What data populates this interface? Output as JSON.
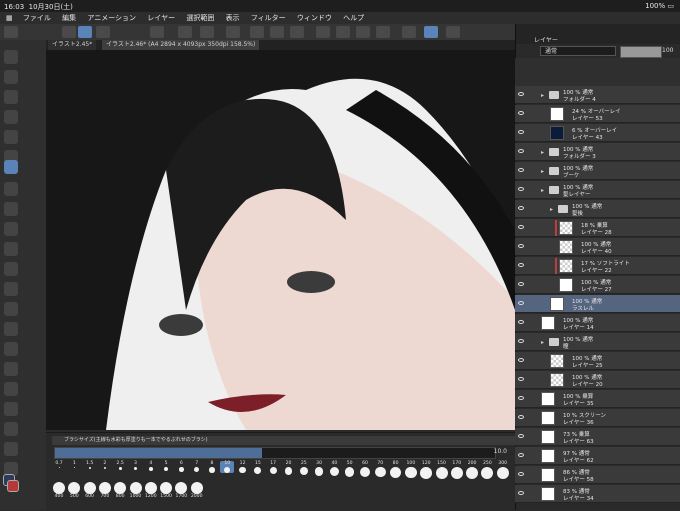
{
  "status": {
    "time": "16:03",
    "date": "10月30日(土)",
    "battery": "100%"
  },
  "menu": [
    "ファイル",
    "編集",
    "アニメーション",
    "レイヤー",
    "選択範囲",
    "表示",
    "フィルター",
    "ウィンドウ",
    "ヘルプ"
  ],
  "canvas_tabs": [
    {
      "label": "イラスト2.45*"
    },
    {
      "label": "イラスト2.46* (A4 2894 x 4093px 350dpi 158.5%)"
    }
  ],
  "brush_panel": {
    "title": "ブラシサイズ(主線も水彩も厚塗りも一本でやるぶれせのブラシ)",
    "current_value": "10.0",
    "selected_size": "10",
    "fill_fraction": 0.47,
    "sizes_row1": [
      "0.7",
      "1",
      "1.5",
      "2",
      "2.5",
      "3",
      "4",
      "5",
      "6",
      "7",
      "8",
      "10",
      "12",
      "15",
      "17",
      "20",
      "25",
      "30",
      "40",
      "50",
      "60",
      "70",
      "80",
      "100",
      "120",
      "150",
      "170",
      "200",
      "250",
      "300"
    ],
    "sizes_row2": [
      "400",
      "500",
      "600",
      "700",
      "800",
      "1000",
      "1200",
      "1500",
      "1700",
      "2000"
    ]
  },
  "layer_panel": {
    "tab_label": "レイヤー",
    "blend_mode": "通常",
    "opacity": "100",
    "layers": [
      {
        "line1": "100 % 通常",
        "line2": "フォルダー 4",
        "kind": "folder",
        "indent": 0
      },
      {
        "line1": "24 % オーバーレイ",
        "line2": "レイヤー 53",
        "kind": "layer",
        "thumb": "white",
        "indent": 1
      },
      {
        "line1": "6 % オーバーレイ",
        "line2": "レイヤー 43",
        "kind": "layer",
        "thumb": "dark",
        "indent": 1
      },
      {
        "line1": "100 % 通常",
        "line2": "フォルダー 3",
        "kind": "folder",
        "indent": 0
      },
      {
        "line1": "100 % 通常",
        "line2": "ブーケ",
        "kind": "folder",
        "indent": 0
      },
      {
        "line1": "100 % 通常",
        "line2": "髪レイヤー",
        "kind": "folder",
        "indent": 0
      },
      {
        "line1": "100 % 通常",
        "line2": "髪後",
        "kind": "folder",
        "indent": 1
      },
      {
        "line1": "18 % 乗算",
        "line2": "レイヤー 28",
        "kind": "layer",
        "thumb": "checker",
        "indent": 2,
        "clip": true
      },
      {
        "line1": "100 % 通常",
        "line2": "レイヤー 40",
        "kind": "layer",
        "thumb": "checker",
        "indent": 2
      },
      {
        "line1": "17 % ソフトライト",
        "line2": "レイヤー 22",
        "kind": "layer",
        "thumb": "checker",
        "indent": 2,
        "clip": true
      },
      {
        "line1": "100 % 通常",
        "line2": "レイヤー 27",
        "kind": "layer",
        "thumb": "white",
        "indent": 2
      },
      {
        "line1": "100 % 通常",
        "line2": "ラスレル",
        "kind": "layer",
        "thumb": "white",
        "indent": 1,
        "selected": true
      },
      {
        "line1": "100 % 通常",
        "line2": "レイヤー 14",
        "kind": "layer",
        "thumb": "white",
        "indent": 0
      },
      {
        "line1": "100 % 通常",
        "line2": "瞳",
        "kind": "folder",
        "indent": 0
      },
      {
        "line1": "100 % 通常",
        "line2": "レイヤー 25",
        "kind": "layer",
        "thumb": "checker",
        "indent": 1
      },
      {
        "line1": "100 % 通常",
        "line2": "レイヤー 20",
        "kind": "layer",
        "thumb": "checker",
        "indent": 1
      },
      {
        "line1": "100 % 乗算",
        "line2": "レイヤー 35",
        "kind": "layer",
        "thumb": "white",
        "indent": 0
      },
      {
        "line1": "10 % スクリーン",
        "line2": "レイヤー 36",
        "kind": "layer",
        "thumb": "white",
        "indent": 0
      },
      {
        "line1": "73 % 乗算",
        "line2": "レイヤー 63",
        "kind": "layer",
        "thumb": "white",
        "indent": 0
      },
      {
        "line1": "97 % 通常",
        "line2": "レイヤー 62",
        "kind": "layer",
        "thumb": "white",
        "indent": 0
      },
      {
        "line1": "86 % 通常",
        "line2": "レイヤー 58",
        "kind": "layer",
        "thumb": "white",
        "indent": 0
      },
      {
        "line1": "83 % 通常",
        "line2": "レイヤー 34",
        "kind": "layer",
        "thumb": "white",
        "indent": 0
      }
    ]
  },
  "colors": {
    "accent": "#5a84b8",
    "main_color": "#2c3a5c",
    "sub_color": "#b73838"
  }
}
